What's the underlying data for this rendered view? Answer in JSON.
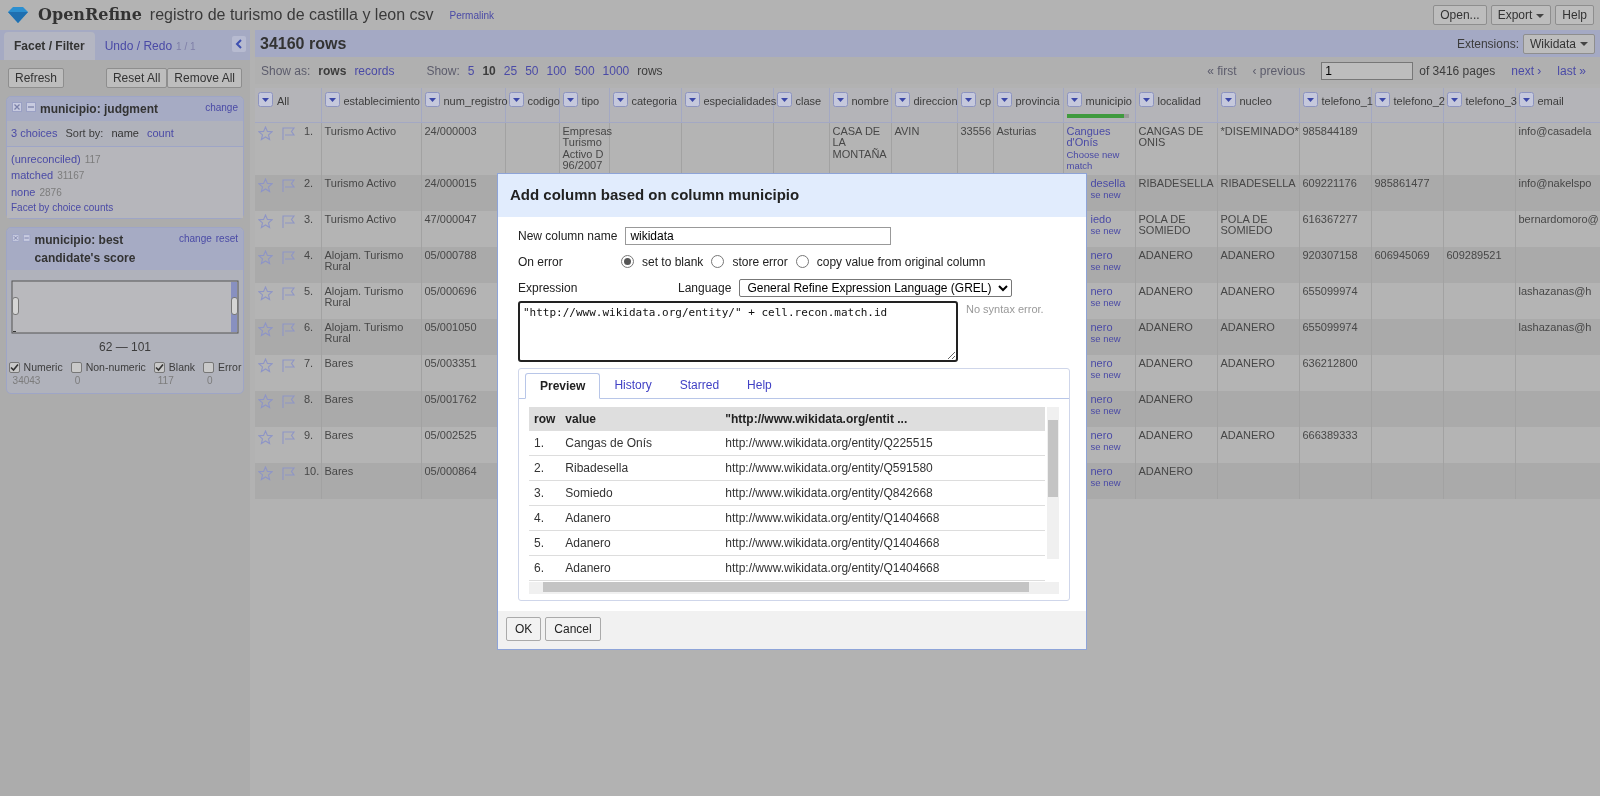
{
  "header": {
    "logo": "OpenRefine",
    "project_title": "registro de turismo de castilla y leon csv",
    "permalink": "Permalink",
    "buttons": [
      {
        "label": "Open...",
        "dropdown": false
      },
      {
        "label": "Export",
        "dropdown": true
      },
      {
        "label": "Help",
        "dropdown": false
      }
    ]
  },
  "left_panel": {
    "tabs": [
      {
        "label": "Facet / Filter",
        "selected": true
      },
      {
        "label": "Undo / Redo",
        "count": "1 / 1",
        "selected": false
      }
    ],
    "refresh": "Refresh",
    "reset_all": "Reset All",
    "remove_all": "Remove All",
    "facets": [
      {
        "kind": "list",
        "title": "municipio: judgment",
        "actions": [
          "change"
        ],
        "choices_count": "3 choices",
        "sort_label": "Sort by:",
        "sort_options": [
          {
            "label": "name",
            "selected": true
          },
          {
            "label": "count",
            "selected": false
          }
        ],
        "choices": [
          {
            "label": "(unreconciled)",
            "count": "117"
          },
          {
            "label": "matched",
            "count": "31167"
          },
          {
            "label": "none",
            "count": "2876"
          }
        ],
        "footer_link": "Facet by choice counts"
      },
      {
        "kind": "range",
        "title": "municipio: best candidate's score",
        "actions": [
          "change",
          "reset"
        ],
        "range_label": "62 — 101",
        "options": [
          {
            "label": "Numeric",
            "count": "34043",
            "checked": true
          },
          {
            "label": "Non-numeric",
            "count": "0",
            "checked": false
          },
          {
            "label": "Blank",
            "count": "117",
            "checked": true
          },
          {
            "label": "Error",
            "count": "0",
            "checked": false
          }
        ]
      }
    ]
  },
  "grid": {
    "row_count": "34160 rows",
    "extensions_label": "Extensions:",
    "extensions_button": "Wikidata",
    "show_as_label": "Show as:",
    "show_as": [
      {
        "label": "rows",
        "selected": true
      },
      {
        "label": "records",
        "selected": false
      }
    ],
    "show_label": "Show:",
    "page_sizes": [
      {
        "label": "5",
        "selected": false
      },
      {
        "label": "10",
        "selected": true
      },
      {
        "label": "25",
        "selected": false
      },
      {
        "label": "50",
        "selected": false
      },
      {
        "label": "100",
        "selected": false
      },
      {
        "label": "500",
        "selected": false
      },
      {
        "label": "1000",
        "selected": false
      }
    ],
    "page_sizes_suffix": "rows",
    "pager": {
      "back": [
        {
          "label": "« first",
          "disabled": true
        },
        {
          "label": "‹ previous",
          "disabled": true
        }
      ],
      "page": "1",
      "of_pages": "of 3416 pages",
      "forward": [
        {
          "label": "next ›",
          "disabled": false
        },
        {
          "label": "last »",
          "disabled": false
        }
      ]
    },
    "columns": [
      {
        "name": "All"
      },
      {
        "name": "establecimiento"
      },
      {
        "name": "num_registro"
      },
      {
        "name": "codigo"
      },
      {
        "name": "tipo"
      },
      {
        "name": "categoria"
      },
      {
        "name": "especialidades"
      },
      {
        "name": "clase"
      },
      {
        "name": "nombre"
      },
      {
        "name": "direccion"
      },
      {
        "name": "cp"
      },
      {
        "name": "provincia"
      },
      {
        "name": "municipio",
        "level": 0.93
      },
      {
        "name": "localidad"
      },
      {
        "name": "nucleo"
      },
      {
        "name": "telefono_1"
      },
      {
        "name": "telefono_2"
      },
      {
        "name": "telefono_3"
      },
      {
        "name": "email"
      }
    ],
    "rows": [
      {
        "cells": [
          "1.",
          "Turismo Activo",
          "24/000003",
          "",
          "Empresas Turismo Activo D 96/2007",
          "",
          "",
          "",
          "CASA DE LA MONTAÑA",
          "AVIN",
          "33556",
          "Asturias",
          {
            "kind": "recon",
            "match": "Cangues d'Onís",
            "action": "Choose new match"
          },
          "CANGAS DE ONIS",
          "*DISEMINADO*",
          "985844189",
          "",
          "",
          "info@casadela"
        ]
      },
      {
        "cells": [
          "2.",
          "Turismo Activo",
          "24/000015",
          "",
          "",
          "",
          "",
          "",
          "",
          "",
          "",
          "",
          {
            "kind": "recon_clipped",
            "match": "desella",
            "action": "se new"
          },
          "RIBADESELLA",
          "RIBADESELLA",
          "609221176",
          "985861477",
          "",
          "info@nakelspo"
        ]
      },
      {
        "cells": [
          "3.",
          "Turismo Activo",
          "47/000047",
          "",
          "",
          "",
          "",
          "",
          "",
          "",
          "",
          "",
          {
            "kind": "recon_clipped",
            "match": "iedo",
            "action": "se new"
          },
          "POLA DE SOMIEDO",
          "POLA DE SOMIEDO",
          "616367277",
          "",
          "",
          "bernardomoro@"
        ]
      },
      {
        "cells": [
          "4.",
          "Alojam. Turismo Rural",
          "05/000788",
          "",
          "",
          "",
          "",
          "",
          "",
          "",
          "",
          "",
          {
            "kind": "recon_clipped",
            "match": "nero",
            "action": "se new"
          },
          "ADANERO",
          "ADANERO",
          "920307158",
          "606945069",
          "609289521",
          ""
        ]
      },
      {
        "cells": [
          "5.",
          "Alojam. Turismo Rural",
          "05/000696",
          "",
          "",
          "",
          "",
          "",
          "",
          "",
          "",
          "",
          {
            "kind": "recon_clipped",
            "match": "nero",
            "action": "se new"
          },
          "ADANERO",
          "ADANERO",
          "655099974",
          "",
          "",
          "lashazanas@h"
        ]
      },
      {
        "cells": [
          "6.",
          "Alojam. Turismo Rural",
          "05/001050",
          "",
          "",
          "",
          "",
          "",
          "",
          "",
          "",
          "",
          {
            "kind": "recon_clipped",
            "match": "nero",
            "action": "se new"
          },
          "ADANERO",
          "ADANERO",
          "655099974",
          "",
          "",
          "lashazanas@h"
        ]
      },
      {
        "cells": [
          "7.",
          "Bares",
          "05/003351",
          "",
          "",
          "",
          "",
          "",
          "",
          "",
          "",
          "",
          {
            "kind": "recon_clipped",
            "match": "nero",
            "action": "se new"
          },
          "ADANERO",
          "ADANERO",
          "636212800",
          "",
          "",
          ""
        ]
      },
      {
        "cells": [
          "8.",
          "Bares",
          "05/001762",
          "",
          "",
          "",
          "",
          "",
          "",
          "",
          "",
          "",
          {
            "kind": "recon_clipped",
            "match": "nero",
            "action": "se new"
          },
          "ADANERO",
          "",
          "",
          "",
          "",
          ""
        ]
      },
      {
        "cells": [
          "9.",
          "Bares",
          "05/002525",
          "",
          "",
          "",
          "",
          "",
          "",
          "",
          "",
          "",
          {
            "kind": "recon_clipped",
            "match": "nero",
            "action": "se new"
          },
          "ADANERO",
          "ADANERO",
          "666389333",
          "",
          "",
          ""
        ]
      },
      {
        "cells": [
          "10.",
          "Bares",
          "05/000864",
          "",
          "",
          "",
          "",
          "",
          "",
          "",
          "",
          "",
          {
            "kind": "recon_clipped",
            "match": "nero",
            "action": "se new"
          },
          "ADANERO",
          "",
          "",
          "",
          "",
          ""
        ]
      }
    ]
  },
  "dialog": {
    "title": "Add column based on column municipio",
    "new_column_label": "New column name",
    "new_column_value": "wikidata",
    "on_error_label": "On error",
    "on_error_options": [
      {
        "label": "set to blank",
        "selected": true
      },
      {
        "label": "store error",
        "selected": false
      },
      {
        "label": "copy value from original column",
        "selected": false
      }
    ],
    "expression_label": "Expression",
    "language_label": "Language",
    "language_value": "General Refine Expression Language (GREL)",
    "expression": "\"http://www.wikidata.org/entity/\" + cell.recon.match.id",
    "syntax_status": "No syntax error.",
    "tabs": [
      {
        "label": "Preview",
        "selected": true
      },
      {
        "label": "History",
        "selected": false
      },
      {
        "label": "Starred",
        "selected": false
      },
      {
        "label": "Help",
        "selected": false
      }
    ],
    "preview": {
      "columns": [
        "row",
        "value",
        "\"http://www.wikidata.org/entit ..."
      ],
      "rows": [
        [
          "1.",
          "Cangas de Onís",
          "http://www.wikidata.org/entity/Q225515"
        ],
        [
          "2.",
          "Ribadesella",
          "http://www.wikidata.org/entity/Q591580"
        ],
        [
          "3.",
          "Somiedo",
          "http://www.wikidata.org/entity/Q842668"
        ],
        [
          "4.",
          "Adanero",
          "http://www.wikidata.org/entity/Q1404668"
        ],
        [
          "5.",
          "Adanero",
          "http://www.wikidata.org/entity/Q1404668"
        ],
        [
          "6.",
          "Adanero",
          "http://www.wikidata.org/entity/Q1404668"
        ]
      ]
    },
    "buttons": [
      "OK",
      "Cancel"
    ]
  }
}
